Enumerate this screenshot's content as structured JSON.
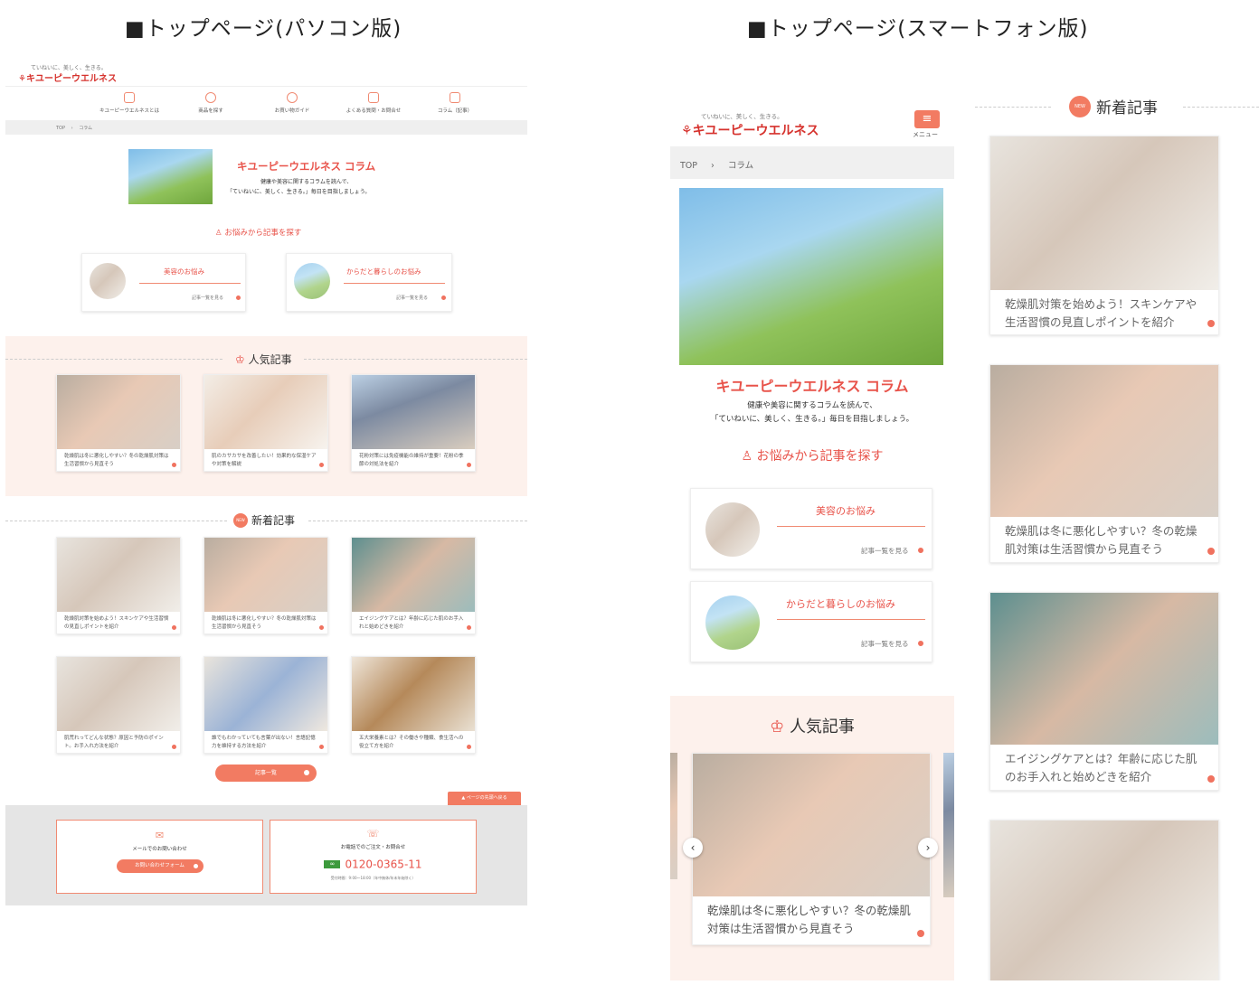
{
  "captions": {
    "pc": "■トップページ(パソコン版)",
    "sp": "■トップページ(スマートフォン版)"
  },
  "pc": {
    "logo_tag": "ていねいに、美しく、生きる。",
    "logo": "キユーピーウエルネス",
    "nav": [
      {
        "label": "キユーピーウエルネスとは",
        "icon": "shop-icon"
      },
      {
        "label": "商品を探す",
        "icon": "search-icon"
      },
      {
        "label": "お買い物ガイド",
        "icon": "guide-icon"
      },
      {
        "label": "よくある質問・お問合せ",
        "icon": "faq-icon"
      },
      {
        "label": "コラム（記事）",
        "icon": "column-icon"
      }
    ],
    "breadcrumb": {
      "top": "TOP",
      "sep": "›",
      "current": "コラム"
    },
    "hero_title": "キユーピーウエルネス コラム",
    "hero_desc1": "健康や美容に関するコラムを読んで、",
    "hero_desc2": "「ていねいに、美しく、生きる。」毎日を目指しましょう。",
    "worry_title": "お悩みから記事を探す",
    "worries": [
      {
        "label": "美容のお悩み",
        "more": "記事一覧を見る"
      },
      {
        "label": "からだと暮らしのお悩み",
        "more": "記事一覧を見る"
      }
    ],
    "popular_title": "人気記事",
    "popular": [
      {
        "text": "乾燥肌は冬に悪化しやすい？冬の乾燥肌対策は生活習慣から見直そう"
      },
      {
        "text": "肌のカサカサを改善したい！効果的な保湿ケアや対策を解説"
      },
      {
        "text": "花粉対策には免疫機能の維持が重要！花粉の季節の対処法を紹介"
      }
    ],
    "new_badge": "NEW",
    "new_title": "新着記事",
    "new_articles": [
      {
        "text": "乾燥肌対策を始めよう！スキンケアや生活習慣の見直しポイントを紹介"
      },
      {
        "text": "乾燥肌は冬に悪化しやすい？冬の乾燥肌対策は生活習慣から見直そう"
      },
      {
        "text": "エイジングケアとは？年齢に応じた肌のお手入れと始めどきを紹介"
      },
      {
        "text": "肌荒れってどんな状態？原因と予防のポイント。お手入れ方法を紹介"
      },
      {
        "text": "誰でもわかっていても言葉が出ない！言語記憶力を維持する方法を紹介"
      },
      {
        "text": "五大栄養素とは？その働きや種類、食生活への役立て方を紹介"
      }
    ],
    "list_button": "記事一覧",
    "back_to_top": "ページの先頭へ戻る",
    "mail_label": "メールでのお問い合わせ",
    "mail_button": "お問い合わせフォーム",
    "tel_label": "お電話でのご注文・お問合せ",
    "tel_number": "0120-0365-11",
    "tel_hours": "受付時間：9:00～18:00（年中無休/年末年始除く）"
  },
  "sp": {
    "logo_tag": "ていねいに、美しく、生きる。",
    "logo": "キユーピーウエルネス",
    "menu_label": "メニュー",
    "breadcrumb": {
      "top": "TOP",
      "sep": "›",
      "current": "コラム"
    },
    "hero_title": "キユーピーウエルネス コラム",
    "hero_desc1": "健康や美容に関するコラムを読んで、",
    "hero_desc2": "「ていねいに、美しく、生きる。」毎日を目指しましょう。",
    "worry_title": "お悩みから記事を探す",
    "worries": [
      {
        "label": "美容のお悩み",
        "more": "記事一覧を見る"
      },
      {
        "label": "からだと暮らしのお悩み",
        "more": "記事一覧を見る"
      }
    ],
    "popular_title": "人気記事",
    "popular_slide": "乾燥肌は冬に悪化しやすい？冬の乾燥肌対策は生活習慣から見直そう",
    "new_badge": "NEW",
    "new_title": "新着記事",
    "new_articles": [
      {
        "text": "乾燥肌対策を始めよう！スキンケアや生活習慣の見直しポイントを紹介"
      },
      {
        "text": "乾燥肌は冬に悪化しやすい？冬の乾燥肌対策は生活習慣から見直そう"
      },
      {
        "text": "エイジングケアとは？年齢に応じた肌のお手入れと始めどきを紹介"
      }
    ]
  },
  "colors": {
    "accent": "#f27b62",
    "logo": "#d6322d",
    "title": "#e8534a",
    "pink_bg": "#fdf1ec"
  }
}
